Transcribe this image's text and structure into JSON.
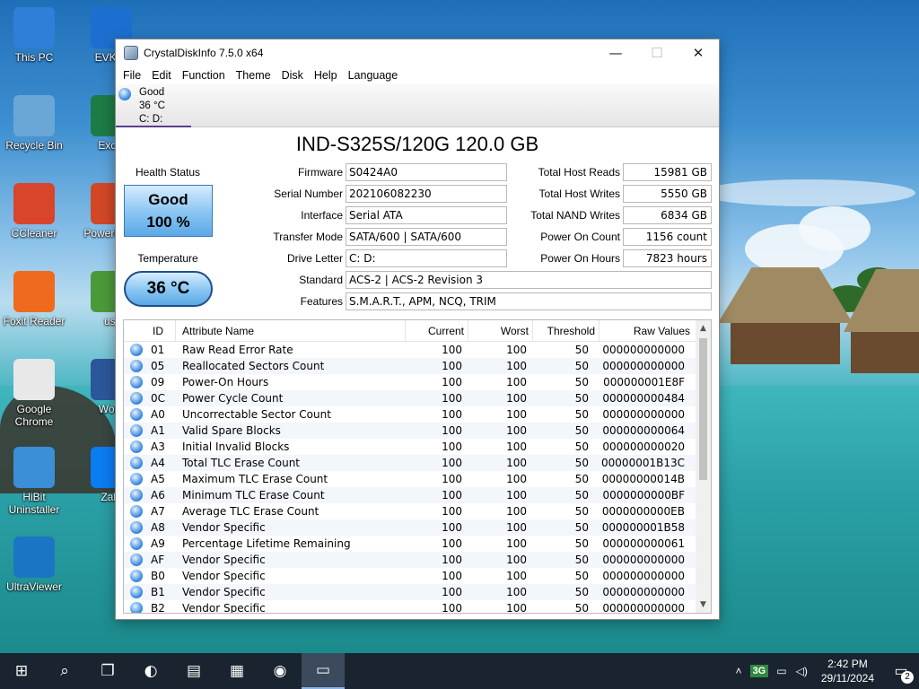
{
  "desktop": {
    "icons": [
      {
        "label": "This PC",
        "color": "#2f7ed8"
      },
      {
        "label": "EVKey",
        "color": "#1c6fd0"
      },
      {
        "label": "Recycle Bin",
        "color": "#6aa7d6"
      },
      {
        "label": "Excel",
        "color": "#1d7b45"
      },
      {
        "label": "CCleaner",
        "color": "#d8452a"
      },
      {
        "label": "PowerPoint",
        "color": "#d24726"
      },
      {
        "label": "Foxit Reader",
        "color": "#f06a1e"
      },
      {
        "label": "usf",
        "color": "#4b9a3a"
      },
      {
        "label": "Google Chrome",
        "color": "#e8e8e8"
      },
      {
        "label": "Word",
        "color": "#2b579a"
      },
      {
        "label": "HiBit Uninstaller",
        "color": "#3a8fd6"
      },
      {
        "label": "Zalo",
        "color": "#0a7df2"
      },
      {
        "label": "UltraViewer",
        "color": "#1a76c4"
      }
    ]
  },
  "window": {
    "title": "CrystalDiskInfo 7.5.0 x64",
    "controls": {
      "minimize": "—",
      "maximize": "☐",
      "close": "✕"
    },
    "menu": [
      "File",
      "Edit",
      "Function",
      "Theme",
      "Disk",
      "Help",
      "Language"
    ],
    "disk_tab": {
      "status": "Good",
      "temp": "36 °C",
      "drives": "C: D:"
    },
    "model": "IND-S325S/120G 120.0 GB",
    "health": {
      "label": "Health Status",
      "status": "Good",
      "percent": "100 %"
    },
    "temperature": {
      "label": "Temperature",
      "value": "36 °C"
    },
    "info_left": [
      {
        "label": "Firmware",
        "value": "S0424A0"
      },
      {
        "label": "Serial Number",
        "value": "202106082230"
      },
      {
        "label": "Interface",
        "value": "Serial ATA"
      },
      {
        "label": "Transfer Mode",
        "value": "SATA/600 | SATA/600"
      },
      {
        "label": "Drive Letter",
        "value": "C: D:"
      }
    ],
    "info_right": [
      {
        "label": "Total Host Reads",
        "value": "15981 GB"
      },
      {
        "label": "Total Host Writes",
        "value": "5550 GB"
      },
      {
        "label": "Total NAND Writes",
        "value": "6834 GB"
      },
      {
        "label": "Power On Count",
        "value": "1156 count"
      },
      {
        "label": "Power On Hours",
        "value": "7823 hours"
      }
    ],
    "standard": {
      "label": "Standard",
      "value": "ACS-2 | ACS-2 Revision 3"
    },
    "features": {
      "label": "Features",
      "value": "S.M.A.R.T., APM, NCQ, TRIM"
    },
    "table": {
      "headers": [
        "ID",
        "Attribute Name",
        "Current",
        "Worst",
        "Threshold",
        "Raw Values"
      ],
      "rows": [
        [
          "01",
          "Raw Read Error Rate",
          "100",
          "100",
          "50",
          "000000000000"
        ],
        [
          "05",
          "Reallocated Sectors Count",
          "100",
          "100",
          "50",
          "000000000000"
        ],
        [
          "09",
          "Power-On Hours",
          "100",
          "100",
          "50",
          "000000001E8F"
        ],
        [
          "0C",
          "Power Cycle Count",
          "100",
          "100",
          "50",
          "000000000484"
        ],
        [
          "A0",
          "Uncorrectable Sector Count",
          "100",
          "100",
          "50",
          "000000000000"
        ],
        [
          "A1",
          "Valid Spare Blocks",
          "100",
          "100",
          "50",
          "000000000064"
        ],
        [
          "A3",
          "Initial Invalid Blocks",
          "100",
          "100",
          "50",
          "000000000020"
        ],
        [
          "A4",
          "Total TLC Erase Count",
          "100",
          "100",
          "50",
          "00000001B13C"
        ],
        [
          "A5",
          "Maximum TLC Erase Count",
          "100",
          "100",
          "50",
          "00000000014B"
        ],
        [
          "A6",
          "Minimum TLC Erase Count",
          "100",
          "100",
          "50",
          "0000000000BF"
        ],
        [
          "A7",
          "Average TLC Erase Count",
          "100",
          "100",
          "50",
          "0000000000EB"
        ],
        [
          "A8",
          "Vendor Specific",
          "100",
          "100",
          "50",
          "000000001B58"
        ],
        [
          "A9",
          "Percentage Lifetime Remaining",
          "100",
          "100",
          "50",
          "000000000061"
        ],
        [
          "AF",
          "Vendor Specific",
          "100",
          "100",
          "50",
          "000000000000"
        ],
        [
          "B0",
          "Vendor Specific",
          "100",
          "100",
          "50",
          "000000000000"
        ],
        [
          "B1",
          "Vendor Specific",
          "100",
          "100",
          "50",
          "000000000000"
        ],
        [
          "B2",
          "Vendor Specific",
          "100",
          "100",
          "50",
          "000000000000"
        ]
      ]
    }
  },
  "taskbar": {
    "apps": [
      {
        "name": "start-button",
        "glyph": "⊞"
      },
      {
        "name": "search-button",
        "glyph": "⌕"
      },
      {
        "name": "task-view-button",
        "glyph": "❐"
      },
      {
        "name": "edge-button",
        "glyph": "◐"
      },
      {
        "name": "file-explorer-button",
        "glyph": "▤"
      },
      {
        "name": "store-button",
        "glyph": "▦"
      },
      {
        "name": "chrome-button",
        "glyph": "◉"
      },
      {
        "name": "crystaldiskinfo-button",
        "glyph": "▭"
      }
    ],
    "tray": {
      "network_badge": "3G",
      "time": "2:42 PM",
      "date": "29/11/2024",
      "notifications": "2"
    }
  }
}
